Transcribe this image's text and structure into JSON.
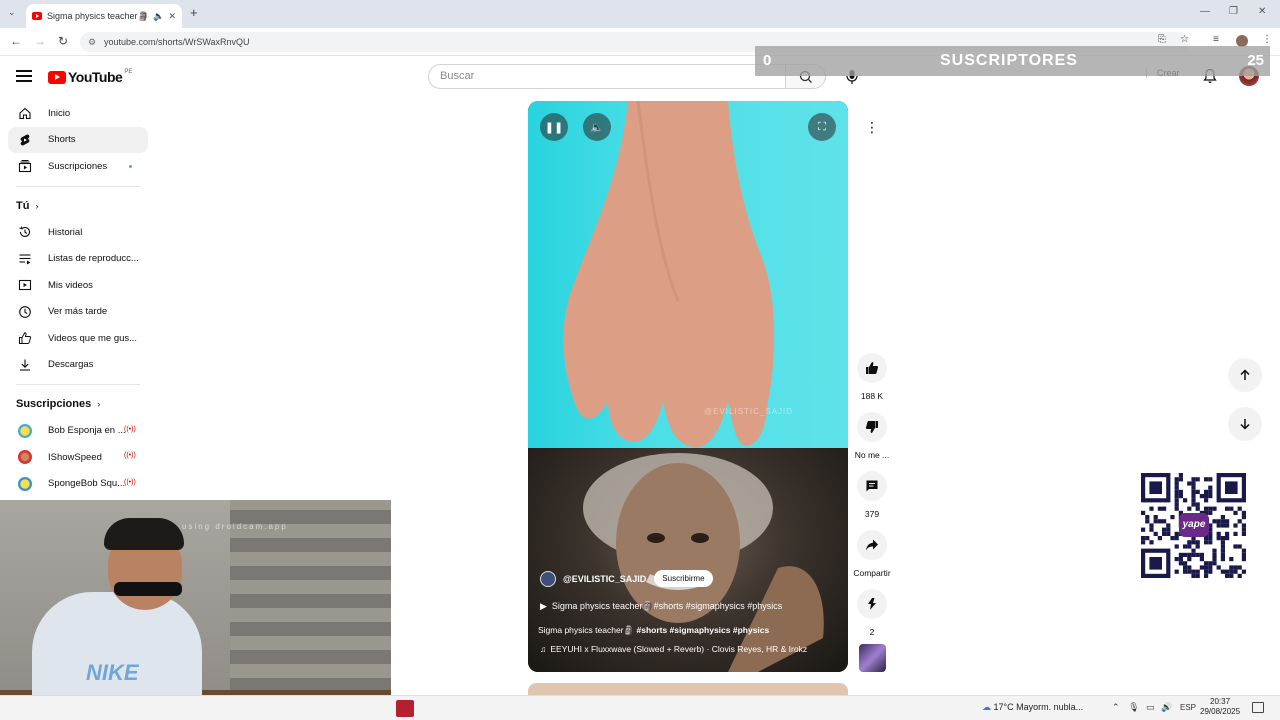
{
  "browser": {
    "tab_title": "Sigma physics teacher🗿#...",
    "url": "youtube.com/shorts/WrSWaxRnvQU",
    "window_controls": [
      "—",
      "❐",
      "✕"
    ]
  },
  "overlay": {
    "left_count": "0",
    "label": "SUSCRIPTORES",
    "right_count": "25"
  },
  "masthead": {
    "logo_text": "YouTube",
    "country_code": "PE",
    "search_placeholder": "Buscar",
    "create_label": "Crear"
  },
  "sidebar": {
    "main": [
      {
        "label": "Inicio",
        "icon": "home-icon"
      },
      {
        "label": "Shorts",
        "icon": "shorts-icon"
      },
      {
        "label": "Suscripciones",
        "icon": "subscriptions-icon"
      }
    ],
    "you_header": "Tú",
    "you": [
      {
        "label": "Historial",
        "icon": "history-icon"
      },
      {
        "label": "Listas de reproducc...",
        "icon": "playlists-icon"
      },
      {
        "label": "Mis videos",
        "icon": "my-videos-icon"
      },
      {
        "label": "Ver más tarde",
        "icon": "watch-later-icon"
      },
      {
        "label": "Videos que me gus...",
        "icon": "liked-icon"
      },
      {
        "label": "Descargas",
        "icon": "downloads-icon"
      }
    ],
    "subs_header": "Suscripciones",
    "channels": [
      {
        "label": "Bob Esponja en ...",
        "live": "((•))"
      },
      {
        "label": "IShowSpeed",
        "live": "((•))"
      },
      {
        "label": "SpongeBob Squ...",
        "live": "((•))"
      }
    ]
  },
  "short": {
    "watermark": "@EVILISTIC_SAJID",
    "channel": "@EVILISTIC_SAJID",
    "subscribe_label": "Suscribirme",
    "title": "Sigma physics teacher🗿#shorts #sigmaphysics #physics",
    "desc_plain": "Sigma physics teacher🗿",
    "desc_tags": "#shorts #sigmaphysics #physics",
    "music": "EEYUHI x Fluxxwave (Slowed + Reverb) · Clovis Reyes, HR & Irokz"
  },
  "actions": {
    "likes": "188 K",
    "dislike_label": "No me ...",
    "comments": "379",
    "share_label": "Compartir",
    "remix_count": "2"
  },
  "webcam": {
    "watermark": "using droidcam.app",
    "shirt_text": "NIKE"
  },
  "qr": {
    "logo_text": "yape"
  },
  "taskbar": {
    "weather": "17°C  Mayorm. nubla...",
    "lang": "ESP",
    "time": "20:37",
    "date": "29/08/2025"
  }
}
